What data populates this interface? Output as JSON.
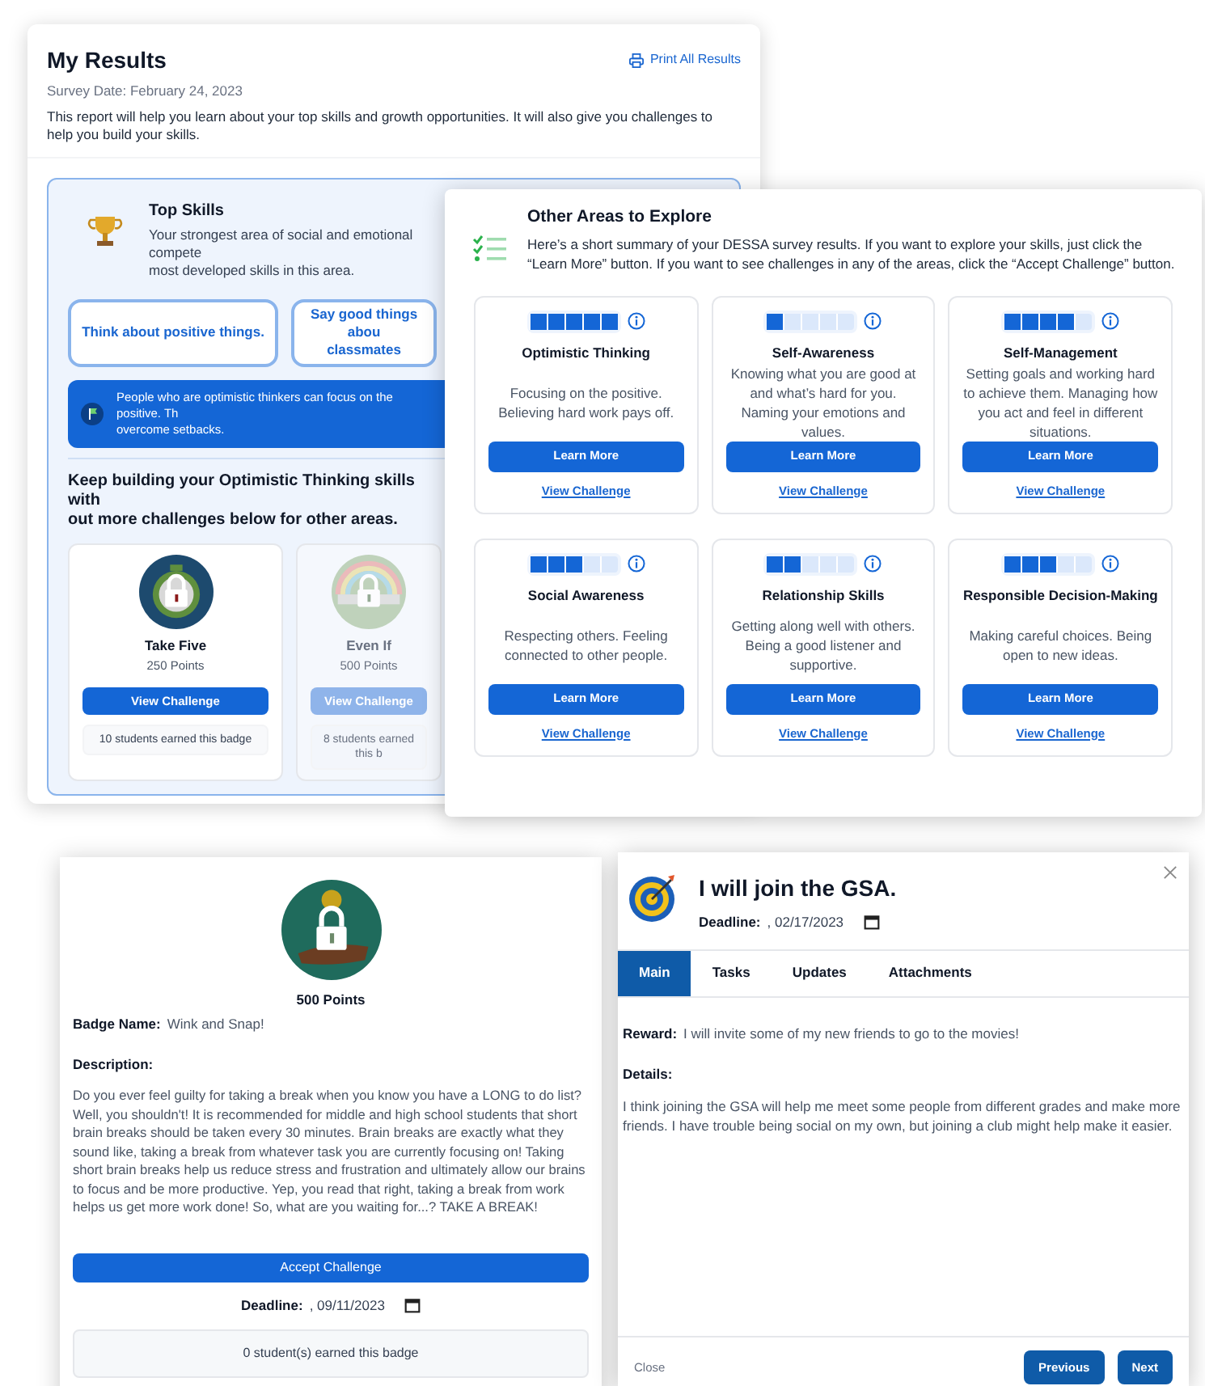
{
  "results": {
    "title": "My Results",
    "print_link": "Print All Results",
    "survey_date": "Survey Date: February 24, 2023",
    "intro": "This report will help you learn about your top skills and growth opportunities. It will also give you challenges to help you build your skills.",
    "top_skills": {
      "title": "Top Skills",
      "description_lines": [
        "Your strongest area of social and emotional compete",
        "most developed skills in this area."
      ],
      "suggestions": [
        {
          "lines": [
            "Think about positive things."
          ]
        },
        {
          "lines": [
            "Say good things abou",
            "classmates"
          ]
        }
      ],
      "tip_lines": [
        "People who are optimistic thinkers can focus on the positive. Th",
        "overcome setbacks."
      ],
      "keep_building_lines": [
        "Keep building your Optimistic Thinking skills with",
        "out more challenges below for other areas."
      ],
      "badges": [
        {
          "name": "Take Five",
          "points": "250 Points",
          "button": "View Challenge",
          "earned": "10 students earned this badge",
          "disabled": false
        },
        {
          "name": "Even If",
          "points": "500 Points",
          "button": "View Challenge",
          "earned": "8 students earned this b",
          "disabled": true
        }
      ]
    }
  },
  "other_areas": {
    "title": "Other Areas to Explore",
    "description": "Here’s a short summary of your DESSA survey results. If you want to explore your skills, just click the “Learn More” button. If you want to see challenges in any of the areas, click the “Accept Challenge” button.",
    "areas": [
      {
        "title": "Optimistic Thinking",
        "level": 1.0,
        "description": "Focusing on the positive. Believing hard work pays off.",
        "button": "Learn More",
        "link": "View Challenge"
      },
      {
        "title": "Self-Awareness",
        "level": 0.2,
        "description": "Knowing what you are good at and what’s hard for you. Naming your emotions and values.",
        "button": "Learn More",
        "link": "View Challenge"
      },
      {
        "title": "Self-Management",
        "level": 0.8,
        "description": "Setting goals and working hard to achieve them. Managing how you act and feel in different situations.",
        "button": "Learn More",
        "link": "View Challenge"
      },
      {
        "title": "Social Awareness",
        "level": 0.6,
        "description": "Respecting others. Feeling connected to other people.",
        "button": "Learn More",
        "link": "View Challenge"
      },
      {
        "title": "Relationship Skills",
        "level": 0.4,
        "description": "Getting along well with others. Being a good listener and supportive.",
        "button": "Learn More",
        "link": "View Challenge"
      },
      {
        "title": "Responsible Decision-Making",
        "level": 0.6,
        "description": "Making careful choices. Being open to new ideas.",
        "button": "Learn More",
        "link": "View Challenge"
      }
    ]
  },
  "badge_detail": {
    "points": "500 Points",
    "name_label": "Badge Name:",
    "name": "Wink and Snap!",
    "description_label": "Description:",
    "description": "Do you ever feel guilty for taking a break when you know you have a LONG to do list? Well, you shouldn't! It is recommended for middle and high school students that short brain breaks should be taken every 30 minutes. Brain breaks are exactly what they sound like, taking a break from whatever task you are currently focusing on! Taking short brain breaks help us reduce stress and frustration and ultimately allow our brains to focus and be more productive. Yep, you read that right, taking a break from work helps us get more work done! So, what are you waiting for...? TAKE A BREAK!",
    "button": "Accept Challenge",
    "deadline_label": "Deadline:",
    "deadline": ", 09/11/2023",
    "earned": "0 student(s) earned this badge"
  },
  "goal": {
    "title": "I will join the GSA.",
    "deadline_label": "Deadline:",
    "deadline": ", 02/17/2023",
    "tabs": [
      {
        "label": "Main",
        "selected": true
      },
      {
        "label": "Tasks",
        "selected": false
      },
      {
        "label": "Updates",
        "selected": false
      },
      {
        "label": "Attachments",
        "selected": false
      }
    ],
    "reward_label": "Reward:",
    "reward": "I will invite some of my new friends to go to the movies!",
    "details_label": "Details:",
    "details": "I think joining the GSA will help me meet some people from different grades and make more friends. I have trouble being social on my own, but joining a club might help make it easier.",
    "close": "Close",
    "previous": "Previous",
    "next": "Next"
  }
}
